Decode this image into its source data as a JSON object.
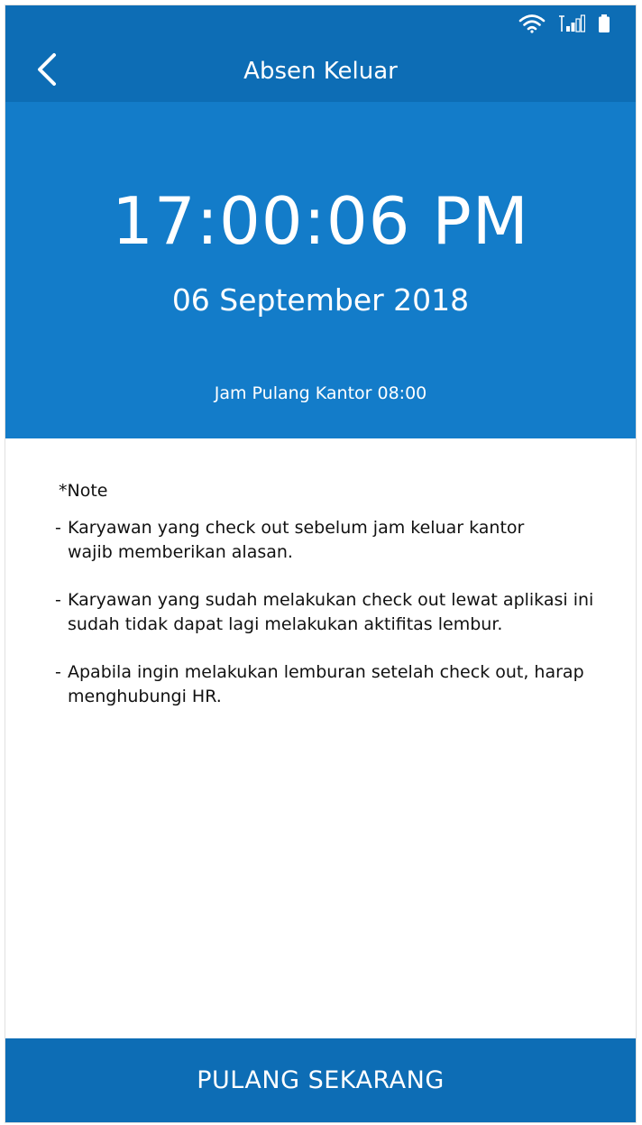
{
  "status_bar": {
    "icons": [
      "wifi-icon",
      "signal-icon",
      "battery-icon"
    ]
  },
  "app_bar": {
    "back_icon": "chevron-left-icon",
    "title": "Absen Keluar"
  },
  "hero": {
    "time": "17:00:06 PM",
    "date": "06 September 2018",
    "office_time": "Jam Pulang Kantor 08:00"
  },
  "notes": {
    "title": "*Note",
    "items": [
      {
        "dash": "-",
        "line1": "Karyawan yang check out sebelum jam keluar kantor",
        "line2": "wajib memberikan alasan."
      },
      {
        "dash": "-",
        "line1": "Karyawan yang sudah melakukan check out lewat aplikasi ini",
        "line2": "sudah tidak dapat lagi melakukan aktifitas lembur."
      },
      {
        "dash": "-",
        "line1": "Apabila ingin melakukan lemburan setelah check out, harap",
        "line2": "menghubungi HR."
      }
    ]
  },
  "action": {
    "button_label": "PULANG SEKARANG"
  },
  "colors": {
    "primary_dark": "#0d6db5",
    "primary": "#137cc9",
    "text": "#111111",
    "on_primary": "#ffffff"
  }
}
